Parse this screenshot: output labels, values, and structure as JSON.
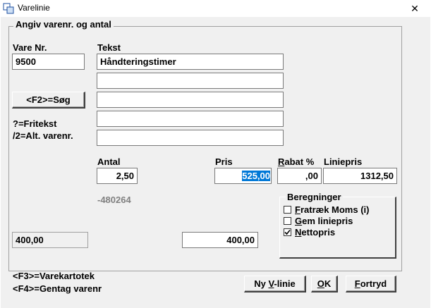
{
  "window": {
    "title": "Varelinie",
    "close_glyph": "✕"
  },
  "group": {
    "title": "Angiv varenr. og antal"
  },
  "labels": {
    "vare_nr": "Vare Nr.",
    "tekst": "Tekst",
    "fritekst_hint": "?=Fritekst",
    "alt_varenr_hint": "/2=Alt. varenr.",
    "antal": "Antal",
    "pris": "Pris",
    "rabat_first": "R",
    "rabat_rest": "abat %",
    "liniepris": "Liniepris",
    "code": "-480264"
  },
  "fields": {
    "vare_nr": "9500",
    "tekst": [
      "Håndteringstimer",
      "",
      "",
      "",
      ""
    ],
    "antal": "2,50",
    "pris": "525,00",
    "rabat": ",00",
    "liniepris": "1312,50",
    "bottom_left": "400,00",
    "bottom_mid": "400,00"
  },
  "buttons": {
    "search": "<F2>=Søg",
    "ny_vlinie_pre": "Ny ",
    "ny_vlinie_u": "V",
    "ny_vlinie_post": "-linie",
    "ok_u": "O",
    "ok_post": "K",
    "fortryd_u": "F",
    "fortryd_post": "ortryd"
  },
  "beregninger": {
    "title": "Beregninger",
    "items": [
      {
        "u": "F",
        "rest": "ratræk Moms (i)",
        "checked": false
      },
      {
        "u": "G",
        "rest": "em liniepris",
        "checked": false
      },
      {
        "u": "N",
        "rest": "ettopris",
        "checked": true
      }
    ]
  },
  "hints": {
    "f3": "<F3>=Varekartotek",
    "f4": "<F4>=Gentag varenr"
  }
}
